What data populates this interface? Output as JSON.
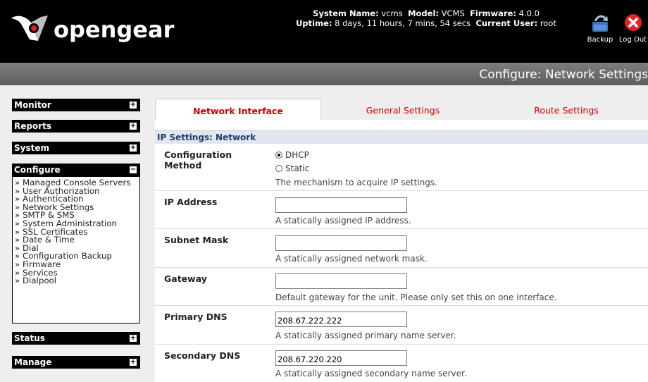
{
  "header": {
    "logo_text": "opengear",
    "system_name_label": "System Name:",
    "system_name": "vcms",
    "model_label": "Model:",
    "model": "VCMS",
    "firmware_label": "Firmware:",
    "firmware": "4.0.0",
    "uptime_label": "Uptime:",
    "uptime": "8 days, 11 hours, 7 mins, 54 secs",
    "current_user_label": "Current User:",
    "current_user": "root",
    "backup_label": "Backup",
    "logout_label": "Log Out"
  },
  "title_bar": {
    "title": "Configure: Network Settings"
  },
  "sidebar": {
    "monitor": "Monitor",
    "reports": "Reports",
    "system": "System",
    "configure": "Configure",
    "configure_items": [
      "» Managed Console Servers",
      "» User Authorization",
      "» Authentication",
      "» Network Settings",
      "» SMTP & SMS",
      "» System Administration",
      "» SSL Certificates",
      "» Date & Time",
      "» Dial",
      "» Configuration Backup",
      "» Firmware",
      "» Services",
      "» Dialpool"
    ],
    "status": "Status",
    "manage": "Manage",
    "expand_symbol": "+",
    "collapse_symbol": "−"
  },
  "tabs": [
    {
      "label": "Network Interface"
    },
    {
      "label": "General Settings"
    },
    {
      "label": "Route Settings"
    }
  ],
  "form": {
    "section_title": "IP Settings: Network",
    "config_method": {
      "label_line1": "Configuration",
      "label_line2": "Method",
      "option_dhcp": "DHCP",
      "option_static": "Static",
      "selected": "DHCP",
      "help": "The mechanism to acquire IP settings."
    },
    "ip_address": {
      "label": "IP Address",
      "value": "",
      "help": "A statically assigned IP address."
    },
    "subnet_mask": {
      "label": "Subnet Mask",
      "value": "",
      "help": "A statically assigned network mask."
    },
    "gateway": {
      "label": "Gateway",
      "value": "",
      "help": "Default gateway for the unit. Please only set this on one interface."
    },
    "primary_dns": {
      "label": "Primary DNS",
      "value": "208.67.222.222",
      "help": "A statically assigned primary name server."
    },
    "secondary_dns": {
      "label": "Secondary DNS",
      "value": "208.67.220.220",
      "help": "A statically assigned secondary name server."
    }
  },
  "colors": {
    "header_bg": "#000000",
    "tab_text": "#cc0000",
    "section_head_bg": "#e3e6ee",
    "section_head_text": "#1d3a6b"
  }
}
